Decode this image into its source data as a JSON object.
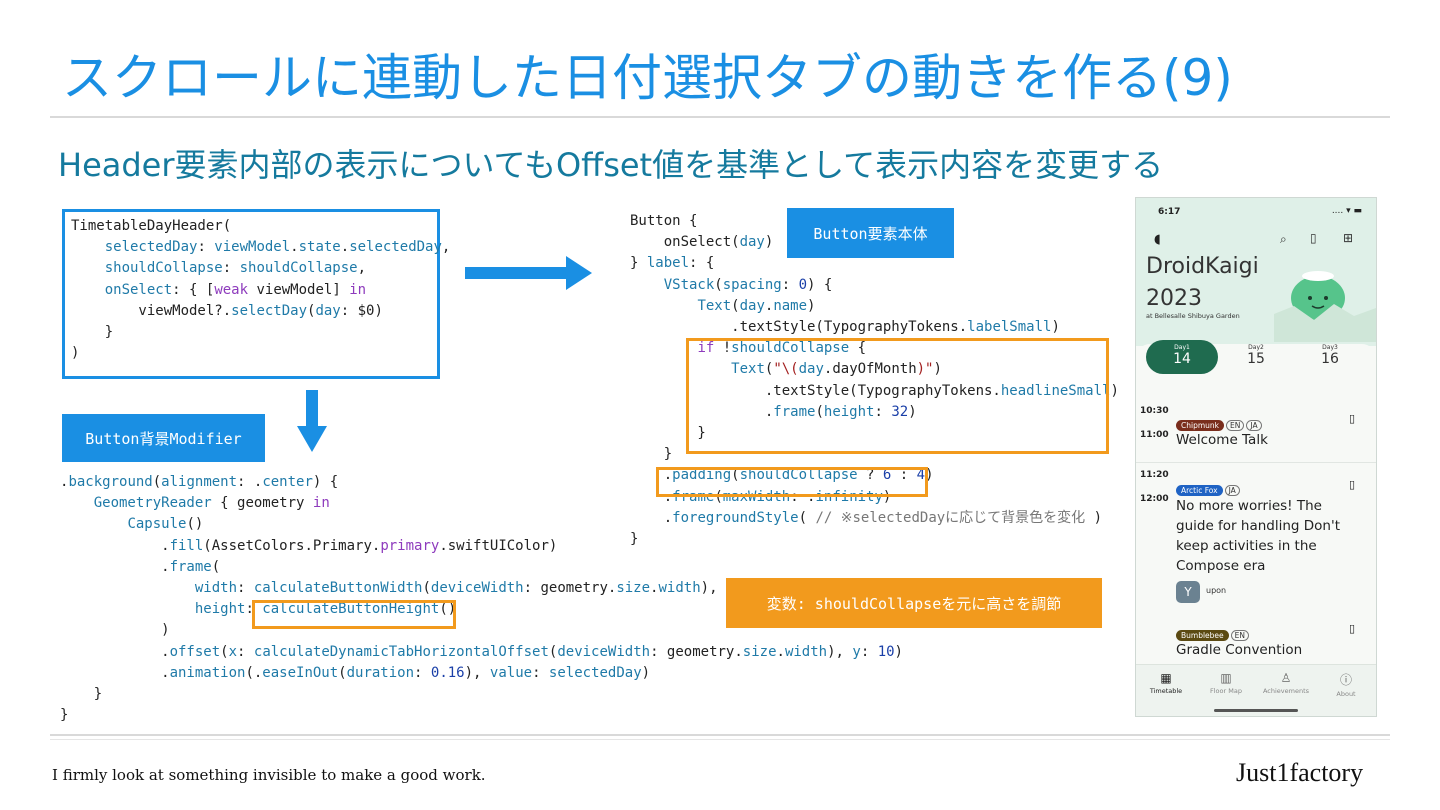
{
  "title": "スクロールに連動した日付選択タブの動きを作る(9)",
  "subtitle": "Header要素内部の表示についてもOffset値を基準として表示内容を変更する",
  "labels": {
    "button_background_modifier": "Button背景Modifier",
    "button_body": "Button要素本体",
    "variable_note": "変数: shouldCollapseを元に高さを調節"
  },
  "footer": {
    "motto": "I firmly look at something invisible to make a good work.",
    "brand": "Just1factory"
  },
  "colors": {
    "accent_blue": "#1a8fe3",
    "accent_orange": "#f29a1d",
    "subtitle_teal": "#157a9e",
    "chip_green": "#1f6b4f"
  },
  "phone": {
    "status_time": "6:17",
    "app_title_line1": "DroidKaigi",
    "app_title_line2": "2023",
    "venue": "at Bellesalle Shibuya Garden",
    "days": [
      {
        "label": "Day1",
        "num": "14"
      },
      {
        "label": "Day2",
        "num": "15"
      },
      {
        "label": "Day3",
        "num": "16"
      }
    ],
    "sessions": [
      {
        "start": "10:30",
        "end": "11:00",
        "room": "Chipmunk",
        "langs": [
          "EN",
          "JA"
        ],
        "title": "Welcome Talk"
      },
      {
        "start": "11:20",
        "end": "12:00",
        "room": "Arctic Fox",
        "langs": [
          "JA"
        ],
        "title": "No more worries! The guide for handling Don't keep activities in the Compose era",
        "speaker_initial": "Y",
        "speaker": "upon"
      },
      {
        "room": "Bumblebee",
        "langs": [
          "EN"
        ],
        "title": "Gradle Convention"
      }
    ],
    "nav": [
      "Timetable",
      "Floor Map",
      "Achievements",
      "About"
    ]
  }
}
